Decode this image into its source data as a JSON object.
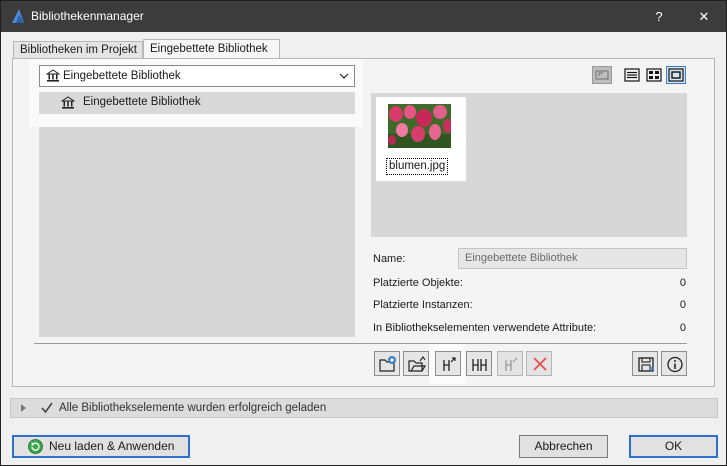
{
  "window": {
    "title": "Bibliothekenmanager",
    "help_label": "?",
    "close_label": "✕"
  },
  "tabs": [
    {
      "label": "Bibliotheken im Projekt",
      "active": false
    },
    {
      "label": "Eingebettete Bibliothek",
      "active": true
    }
  ],
  "library_selector": {
    "selected": "Eingebettete Bibliothek",
    "icon": "library-icon"
  },
  "tree": {
    "items": [
      {
        "label": "Eingebettete Bibliothek",
        "icon": "library-icon"
      }
    ]
  },
  "view_modes": {
    "buttons": [
      "folder-up-icon",
      "list-view-icon",
      "grid-view-icon",
      "large-icon-view-icon"
    ],
    "selected": "large-icon-view-icon"
  },
  "preview": {
    "files": [
      {
        "name": "blumen.jpg",
        "thumbnail": "tulips-image"
      }
    ]
  },
  "properties": {
    "name_label": "Name:",
    "name_value": "Eingebettete Bibliothek",
    "placed_objects_label": "Platzierte Objekte:",
    "placed_objects_value": "0",
    "placed_instances_label": "Platzierte Instanzen:",
    "placed_instances_value": "0",
    "attributes_label": "In Bibliothekselementen verwendete Attribute:",
    "attributes_value": "0"
  },
  "toolbar": {
    "buttons": [
      "new-folder-icon",
      "open-folder-icon",
      "move-object-icon",
      "objects-icon",
      "disabled-move-icon",
      "delete-icon",
      "save-icon",
      "info-icon"
    ]
  },
  "status": {
    "text": "Alle Bibliothekselemente wurden erfolgreich geladen"
  },
  "footer": {
    "reload_label": "Neu laden & Anwenden",
    "cancel_label": "Abbrechen",
    "ok_label": "OK"
  },
  "colors": {
    "titlebar": "#3c3c3c",
    "accent_blue": "#2e6fd0",
    "delete_red": "#e05050"
  }
}
